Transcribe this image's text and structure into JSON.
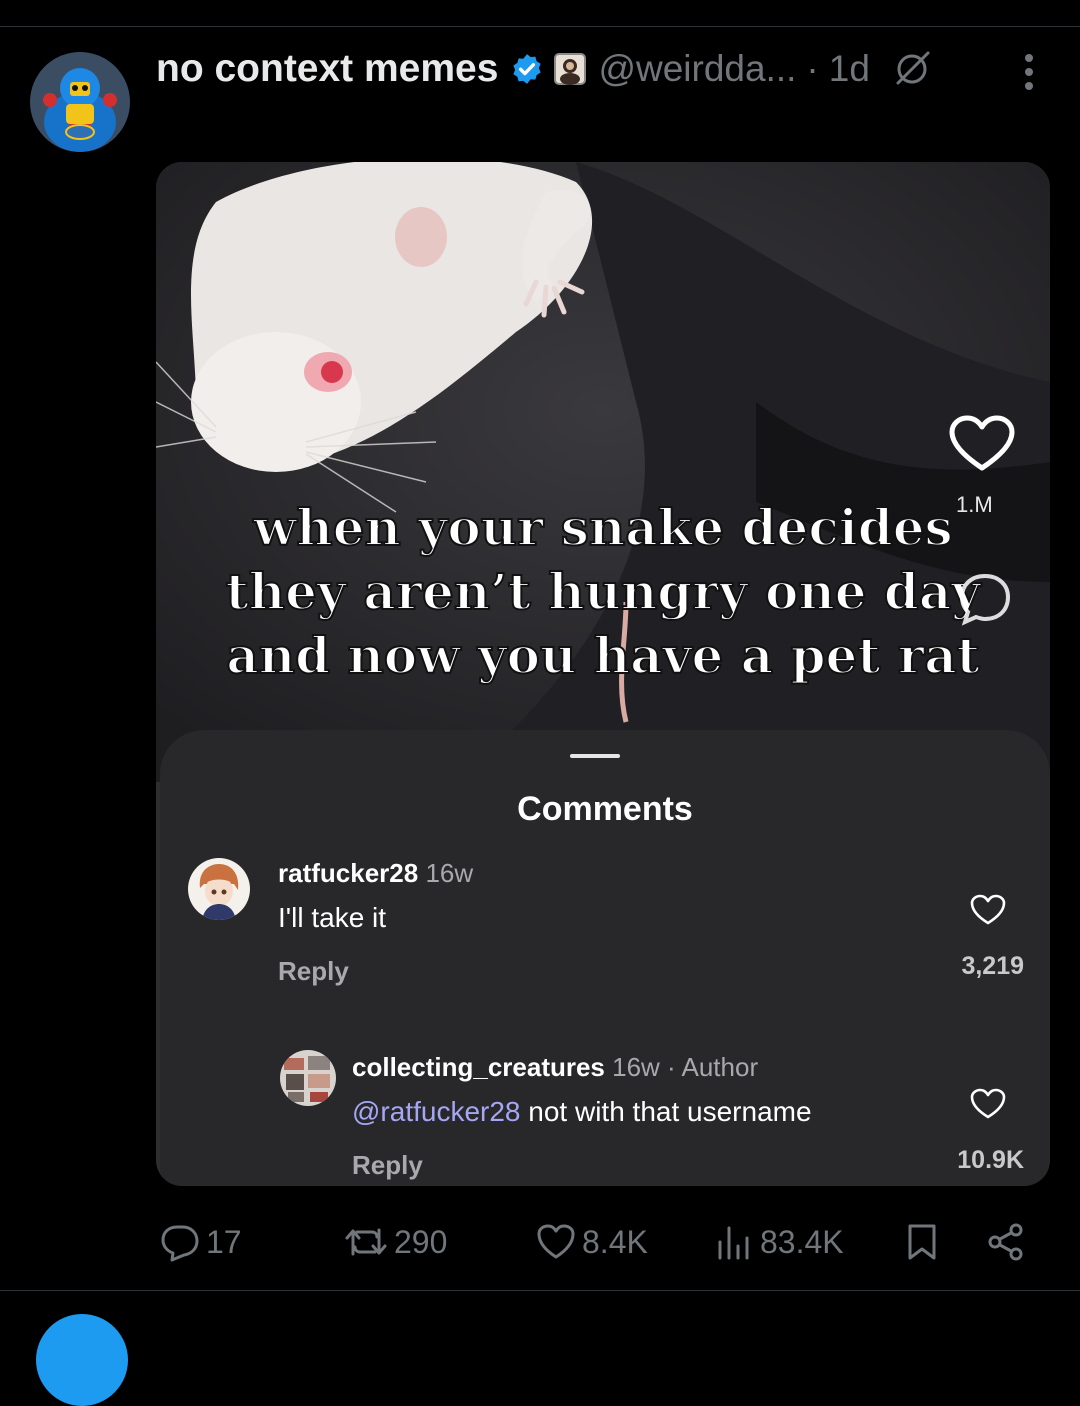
{
  "post": {
    "display_name": "no context memes",
    "handle": "@weirddа...",
    "separator": "·",
    "time": "1d"
  },
  "media": {
    "caption_lines": [
      "when your snake decides",
      "they aren’t hungry one day",
      "and now you have a pet rat"
    ],
    "overlay_like_count": "1.M",
    "sheet_title": "Comments",
    "comments": [
      {
        "username": "ratfucker28",
        "age": "16w",
        "text": "I'll take it",
        "reply_label": "Reply",
        "likes": "3,219"
      },
      {
        "username": "collecting_creatures",
        "age": "16w · Author",
        "mention": "@ratfucker28",
        "text": " not with that username",
        "reply_label": "Reply",
        "likes": "10.9K"
      }
    ]
  },
  "actions": {
    "replies": "17",
    "reposts": "290",
    "likes": "8.4K",
    "views": "83.4K"
  },
  "colors": {
    "verified": "#1d9bf0",
    "muted_text": "#71767b",
    "mention": "#a5a7f5"
  }
}
